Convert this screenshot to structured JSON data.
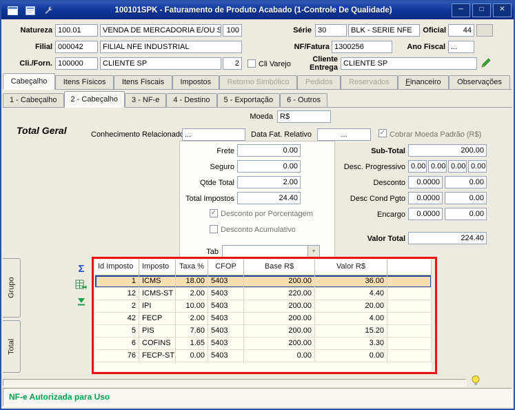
{
  "window": {
    "title": "100101SPK - Faturamento de Produto Acabado (1-Controle De Qualidade)"
  },
  "icons": {
    "minimize": "─",
    "maximize": "□",
    "close": "✕",
    "check": "✓",
    "sigma": "Σ",
    "dropdown_arrow": "▼"
  },
  "form": {
    "natureza": {
      "label": "Natureza",
      "code": "100.01",
      "desc": "VENDA DE MERCADORIA E/OU SERVI",
      "qty": "100"
    },
    "serie": {
      "label": "Série",
      "code": "30",
      "desc": "BLK - SERIE NFE"
    },
    "oficial": {
      "label": "Oficial",
      "value": "44"
    },
    "filial": {
      "label": "Filial",
      "code": "000042",
      "desc": "FILIAL NFE INDUSTRIAL"
    },
    "nf_fatura": {
      "label": "NF/Fatura",
      "value": "1300256"
    },
    "ano_fiscal": {
      "label": "Ano Fiscal",
      "value": "..."
    },
    "cli_forn": {
      "label": "Cli./Forn.",
      "code": "100000",
      "desc": "CLIENTE SP",
      "loja": "2"
    },
    "cli_varejo": {
      "label": "Cli Varejo",
      "checked": false
    },
    "cliente_entrega": {
      "label": "Cliente Entrega",
      "value": "CLIENTE SP"
    }
  },
  "tabs_main": [
    {
      "label": "Cabeçalho",
      "active": true
    },
    {
      "label": "Itens Físicos"
    },
    {
      "label": "Itens Fiscais"
    },
    {
      "label": "Impostos"
    },
    {
      "label": "Retorno Simbólico",
      "disabled": true
    },
    {
      "label": "Pedidos",
      "disabled": true
    },
    {
      "label": "Reservados",
      "disabled": true
    },
    {
      "label": "Financeiro",
      "accel": 0
    },
    {
      "label": "Observações"
    }
  ],
  "tabs_sub": [
    {
      "label": "1 - Cabeçalho"
    },
    {
      "label": "2 - Cabeçalho",
      "active": true
    },
    {
      "label": "3 - NF-e"
    },
    {
      "label": "4 - Destino"
    },
    {
      "label": "5 - Exportação"
    },
    {
      "label": "6 - Outros"
    }
  ],
  "totals": {
    "moeda": {
      "label": "Moeda",
      "value": "R$"
    },
    "total_geral_label": "Total Geral",
    "conhecimento": {
      "label": "Conhecimento Relacionado",
      "value": "..."
    },
    "data_fat": {
      "label": "Data Fat. Relativo",
      "value": "..."
    },
    "cobrar_moeda": {
      "label": "Cobrar Moeda Padrão (R$)",
      "checked": true
    },
    "frete": {
      "label": "Frete",
      "value": "0.00"
    },
    "seguro": {
      "label": "Seguro",
      "value": "0.00"
    },
    "qtde_total": {
      "label": "Qtde Total",
      "value": "2.00"
    },
    "total_impostos": {
      "label": "Total Impostos",
      "value": "24.40"
    },
    "desconto_porcentagem": {
      "label": "Desconto por Porcentagem",
      "checked": true
    },
    "desconto_acumulativo": {
      "label": "Desconto Acumulativo",
      "checked": false
    },
    "tab_select": {
      "label": "Tab",
      "value": ""
    },
    "sub_total": {
      "label": "Sub-Total",
      "value": "200.00"
    },
    "desc_progressivo": {
      "label": "Desc. Progressivo",
      "values": [
        "0.00",
        "0.00",
        "0.00",
        "0.00"
      ]
    },
    "desconto": {
      "label": "Desconto",
      "pct": "0.0000",
      "value": "0.00"
    },
    "desc_cond_pgto": {
      "label": "Desc Cond Pgto",
      "pct": "0.0000",
      "value": "0.00"
    },
    "encargo": {
      "label": "Encargo",
      "pct": "0.0000",
      "value": "0.00"
    },
    "valor_total": {
      "label": "Valor Total",
      "value": "224.40"
    }
  },
  "impostos_table": {
    "columns": [
      "Id Imposto",
      "Imposto",
      "Taxa %",
      "CFOP",
      "Base R$",
      "Valor R$"
    ],
    "rows": [
      [
        "1",
        "ICMS",
        "18.00",
        "5403",
        "200.00",
        "36.00"
      ],
      [
        "12",
        "ICMS-ST",
        "2.00",
        "5403",
        "220.00",
        "4.40"
      ],
      [
        "2",
        "IPI",
        "10.00",
        "5403",
        "200.00",
        "20.00"
      ],
      [
        "42",
        "FECP",
        "2.00",
        "5403",
        "200.00",
        "4.00"
      ],
      [
        "5",
        "PIS",
        "7.60",
        "5403",
        "200.00",
        "15.20"
      ],
      [
        "6",
        "COFINS",
        "1.65",
        "5403",
        "200.00",
        "3.30"
      ],
      [
        "76",
        "FECP-ST",
        "0.00",
        "5403",
        "0.00",
        "0.00"
      ]
    ],
    "selected_row": 0
  },
  "side_tabs": [
    "Grupo",
    "Total"
  ],
  "status": {
    "message": "NF-e Autorizada para Uso"
  }
}
